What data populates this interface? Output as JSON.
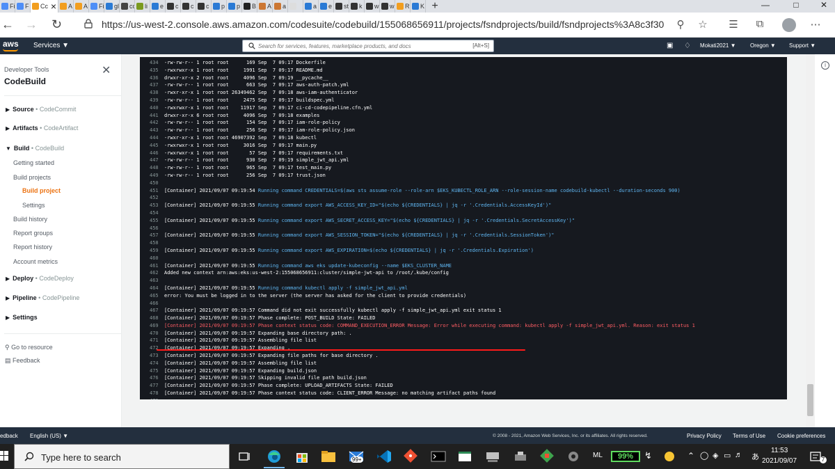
{
  "browser": {
    "active_tab_label": "Cc",
    "url": "https://us-west-2.console.aws.amazon.com/codesuite/codebuild/155068656911/projects/fsndprojects/build/fsndprojects%3A8c3f3030-3ef5-432...",
    "tab_labels": [
      "Fi",
      "F",
      "A",
      "A",
      "Fi",
      "gl",
      "cc",
      "li",
      "e",
      "c",
      "c",
      "c",
      "p",
      "p",
      "B",
      "A",
      "a",
      "",
      "a",
      "e",
      "st",
      "k",
      "w",
      "w",
      "R",
      "K"
    ]
  },
  "awsnav": {
    "logo": "aws",
    "services": "Services ▼",
    "search_placeholder": "Search for services, features, marketplace products, and docs",
    "search_shortcut": "[Alt+S]",
    "account": "Mokati2021 ▼",
    "region": "Oregon ▼",
    "support": "Support ▼"
  },
  "sidebar": {
    "header_small": "Developer Tools",
    "title": "CodeBuild",
    "source": {
      "label": "Source",
      "sep": " • ",
      "sub": "CodeCommit"
    },
    "artifacts": {
      "label": "Artifacts",
      "sep": " • ",
      "sub": "CodeArtifact"
    },
    "build": {
      "label": "Build",
      "sep": " • ",
      "sub": "CodeBuild"
    },
    "getting_started": "Getting started",
    "build_projects": "Build projects",
    "build_project": "Build project",
    "settings_sub": "Settings",
    "build_history": "Build history",
    "report_groups": "Report groups",
    "report_history": "Report history",
    "account_metrics": "Account metrics",
    "deploy": {
      "label": "Deploy",
      "sep": " • ",
      "sub": "CodeDeploy"
    },
    "pipeline": {
      "label": "Pipeline",
      "sep": " • ",
      "sub": "CodePipeline"
    },
    "settings": "Settings",
    "go_to_resource": "Go to resource",
    "feedback": "Feedback"
  },
  "log": {
    "lines": [
      {
        "n": "434",
        "t": "-rw-rw-r-- 1 root root      169 Sep  7 09:17 Dockerfile",
        "k": "normal"
      },
      {
        "n": "435",
        "t": "-rwxrwxr-x 1 root root     1991 Sep  7 09:17 README.md",
        "k": "normal"
      },
      {
        "n": "436",
        "t": "drwxr-xr-x 2 root root     4096 Sep  7 09:19 __pycache__",
        "k": "normal"
      },
      {
        "n": "437",
        "t": "-rw-rw-r-- 1 root root      663 Sep  7 09:17 aws-auth-patch.yml",
        "k": "normal"
      },
      {
        "n": "438",
        "t": "-rwxr-xr-x 1 root root 26349462 Sep  7 09:18 aws-iam-authenticator",
        "k": "normal"
      },
      {
        "n": "439",
        "t": "-rw-rw-r-- 1 root root     2475 Sep  7 09:17 buildspec.yml",
        "k": "normal"
      },
      {
        "n": "440",
        "t": "-rwxrwxr-x 1 root root    11917 Sep  7 09:17 ci-cd-codepipeline.cfn.yml",
        "k": "normal"
      },
      {
        "n": "441",
        "t": "drwxr-xr-x 6 root root     4096 Sep  7 09:18 examples",
        "k": "normal"
      },
      {
        "n": "442",
        "t": "-rw-rw-r-- 1 root root      154 Sep  7 09:17 iam-role-policy",
        "k": "normal"
      },
      {
        "n": "443",
        "t": "-rw-rw-r-- 1 root root      256 Sep  7 09:17 iam-role-policy.json",
        "k": "normal"
      },
      {
        "n": "444",
        "t": "-rwxr-xr-x 1 root root 46907392 Sep  7 09:18 kubectl",
        "k": "normal"
      },
      {
        "n": "445",
        "t": "-rwxrwxr-x 1 root root     3016 Sep  7 09:17 main.py",
        "k": "normal"
      },
      {
        "n": "446",
        "t": "-rwxrwxr-x 1 root root       57 Sep  7 09:17 requirements.txt",
        "k": "normal"
      },
      {
        "n": "447",
        "t": "-rw-rw-r-- 1 root root      930 Sep  7 09:19 simple_jwt_api.yml",
        "k": "normal"
      },
      {
        "n": "448",
        "t": "-rw-rw-r-- 1 root root      965 Sep  7 09:17 test_main.py",
        "k": "normal"
      },
      {
        "n": "449",
        "t": "-rw-rw-r-- 1 root root      256 Sep  7 09:17 trust.json",
        "k": "normal"
      },
      {
        "n": "450",
        "t": "",
        "k": "normal"
      },
      {
        "n": "451",
        "t": "[Container] 2021/09/07 09:19:54 ",
        "c": "Running command CREDENTIALS=$(aws sts assume-role --role-arn $EKS_KUBECTL_ROLE_ARN --role-session-name codebuild-kubectl --duration-seconds 900)",
        "k": "cmd"
      },
      {
        "n": "452",
        "t": "",
        "k": "normal"
      },
      {
        "n": "453",
        "t": "[Container] 2021/09/07 09:19:55 ",
        "c": "Running command export AWS_ACCESS_KEY_ID=\"$(echo ${CREDENTIALS} | jq -r '.Credentials.AccessKeyId')\"",
        "k": "cmd"
      },
      {
        "n": "454",
        "t": "",
        "k": "normal"
      },
      {
        "n": "455",
        "t": "[Container] 2021/09/07 09:19:55 ",
        "c": "Running command export AWS_SECRET_ACCESS_KEY=\"$(echo ${CREDENTIALS} | jq -r '.Credentials.SecretAccessKey')\"",
        "k": "cmd"
      },
      {
        "n": "456",
        "t": "",
        "k": "normal"
      },
      {
        "n": "457",
        "t": "[Container] 2021/09/07 09:19:55 ",
        "c": "Running command export AWS_SESSION_TOKEN=\"$(echo ${CREDENTIALS} | jq -r '.Credentials.SessionToken')\"",
        "k": "cmd"
      },
      {
        "n": "458",
        "t": "",
        "k": "normal"
      },
      {
        "n": "459",
        "t": "[Container] 2021/09/07 09:19:55 ",
        "c": "Running command export AWS_EXPIRATION=$(echo ${CREDENTIALS} | jq -r '.Credentials.Expiration')",
        "k": "cmd"
      },
      {
        "n": "460",
        "t": "",
        "k": "normal"
      },
      {
        "n": "461",
        "t": "[Container] 2021/09/07 09:19:55 ",
        "c": "Running command aws eks update-kubeconfig --name $EKS_CLUSTER_NAME",
        "k": "cmd"
      },
      {
        "n": "462",
        "t": "Added new context arn:aws:eks:us-west-2:155068656911:cluster/simple-jwt-api to /root/.kube/config",
        "k": "normal"
      },
      {
        "n": "463",
        "t": "",
        "k": "normal"
      },
      {
        "n": "464",
        "t": "[Container] 2021/09/07 09:19:55 ",
        "c": "Running command kubectl apply -f simple_jwt_api.yml",
        "k": "cmd"
      },
      {
        "n": "465",
        "t": "error: You must be logged in to the server (the server has asked for the client to provide credentials)",
        "k": "normal"
      },
      {
        "n": "466",
        "t": "",
        "k": "normal"
      },
      {
        "n": "467",
        "t": "[Container] 2021/09/07 09:19:57 Command did not exit successfully kubectl apply -f simple_jwt_api.yml exit status 1",
        "k": "normal"
      },
      {
        "n": "468",
        "t": "[Container] 2021/09/07 09:19:57 Phase complete: POST_BUILD State: FAILED",
        "k": "normal"
      },
      {
        "n": "469",
        "t": "[Container] 2021/09/07 09:19:57 Phase context status code: COMMAND_EXECUTION_ERROR Message: Error while executing command: kubectl apply -f simple_jwt_api.yml. Reason: exit status 1",
        "k": "err"
      },
      {
        "n": "470",
        "t": "[Container] 2021/09/07 09:19:57 Expanding base directory path: .",
        "k": "normal"
      },
      {
        "n": "471",
        "t": "[Container] 2021/09/07 09:19:57 Assembling file list",
        "k": "normal"
      },
      {
        "n": "472",
        "t": "[Container] 2021/09/07 09:19:57 Expanding .",
        "k": "normal"
      },
      {
        "n": "473",
        "t": "[Container] 2021/09/07 09:19:57 Expanding file paths for base directory .",
        "k": "normal"
      },
      {
        "n": "474",
        "t": "[Container] 2021/09/07 09:19:57 Assembling file list",
        "k": "normal"
      },
      {
        "n": "475",
        "t": "[Container] 2021/09/07 09:19:57 Expanding build.json",
        "k": "normal"
      },
      {
        "n": "476",
        "t": "[Container] 2021/09/07 09:19:57 Skipping invalid file path build.json",
        "k": "normal"
      },
      {
        "n": "477",
        "t": "[Container] 2021/09/07 09:19:57 Phase complete: UPLOAD_ARTIFACTS State: FAILED",
        "k": "normal"
      },
      {
        "n": "478",
        "t": "[Container] 2021/09/07 09:19:57 Phase context status code: CLIENT_ERROR Message: no matching artifact paths found",
        "k": "normal"
      },
      {
        "n": "479",
        "t": "",
        "k": "normal"
      }
    ]
  },
  "footer": {
    "feedback": "edback",
    "language": "English (US) ▼",
    "copyright": "© 2008 - 2021, Amazon Web Services, Inc. or its affiliates. All rights reserved.",
    "privacy": "Privacy Policy",
    "terms": "Terms of Use",
    "cookies": "Cookie preferences"
  },
  "taskbar": {
    "search_placeholder": "Type here to search",
    "mail_badge": "99+",
    "lang": "ML",
    "battery": "99%",
    "time": "11:53",
    "date": "2021/09/07",
    "notification_count": "7"
  },
  "colors": {
    "aws_nav": "#232f3e",
    "aws_orange": "#ec7211",
    "log_bg": "#16191f",
    "log_cmd": "#5fb6f2",
    "log_err": "#ff5d64"
  }
}
